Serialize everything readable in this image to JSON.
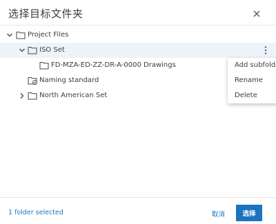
{
  "dialog": {
    "title": "选择目标文件夹",
    "status": "1 folder selected",
    "cancel_label": "取消",
    "select_label": "选择",
    "accent_color": "#1c73be",
    "highlight_color": "#edf3f9"
  },
  "tree": {
    "root": {
      "label": "Project Files",
      "expanded": true
    },
    "iso_set": {
      "label": "ISO Set",
      "expanded": true,
      "hovered": true
    },
    "drawings": {
      "label": "FD-MZA-ED-ZZ-DR-A-0000 Drawings"
    },
    "naming": {
      "label": "Naming standard",
      "icon": "folder-check-icon"
    },
    "north_american": {
      "label": "North American Set",
      "expanded": false
    }
  },
  "context_menu": {
    "items": [
      "Add subfolder",
      "Rename",
      "Delete"
    ]
  },
  "icons": {
    "close": "close-icon",
    "folder": "folder-icon",
    "more": "more-vertical-icon",
    "chevron_down": "chevron-down-icon",
    "chevron_right": "chevron-right-icon"
  }
}
